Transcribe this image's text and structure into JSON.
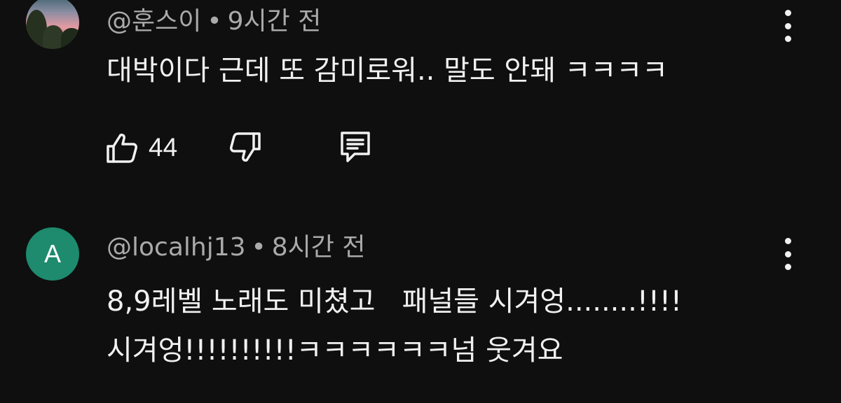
{
  "comments": [
    {
      "avatar": "landscape-photo",
      "author": "@훈스이",
      "time": "9시간 전",
      "lines": [
        "대박이다 근데 또 감미로워.. 말도 안돼 ㅋㅋㅋㅋ"
      ],
      "likes": "44",
      "icons": [
        "thumbs-up-icon",
        "thumbs-down-icon",
        "reply-icon",
        "more-vert-icon"
      ]
    },
    {
      "avatar_letter": "A",
      "avatar_color": "#1e8a6e",
      "author": "@localhj13",
      "time": "8시간 전",
      "lines": [
        "8,9레벨 노래도 미쳤고   패널들 시겨엉........!!!!",
        "시겨엉!!!!!!!!!!ㅋㅋㅋㅋㅋㅋ넘 웃겨요"
      ]
    }
  ],
  "separator": "•",
  "colors": {
    "background": "#0f0f0f",
    "text": "#f1f1f1",
    "meta": "#aaaaaa",
    "avatar_a": "#1e8a6e"
  }
}
